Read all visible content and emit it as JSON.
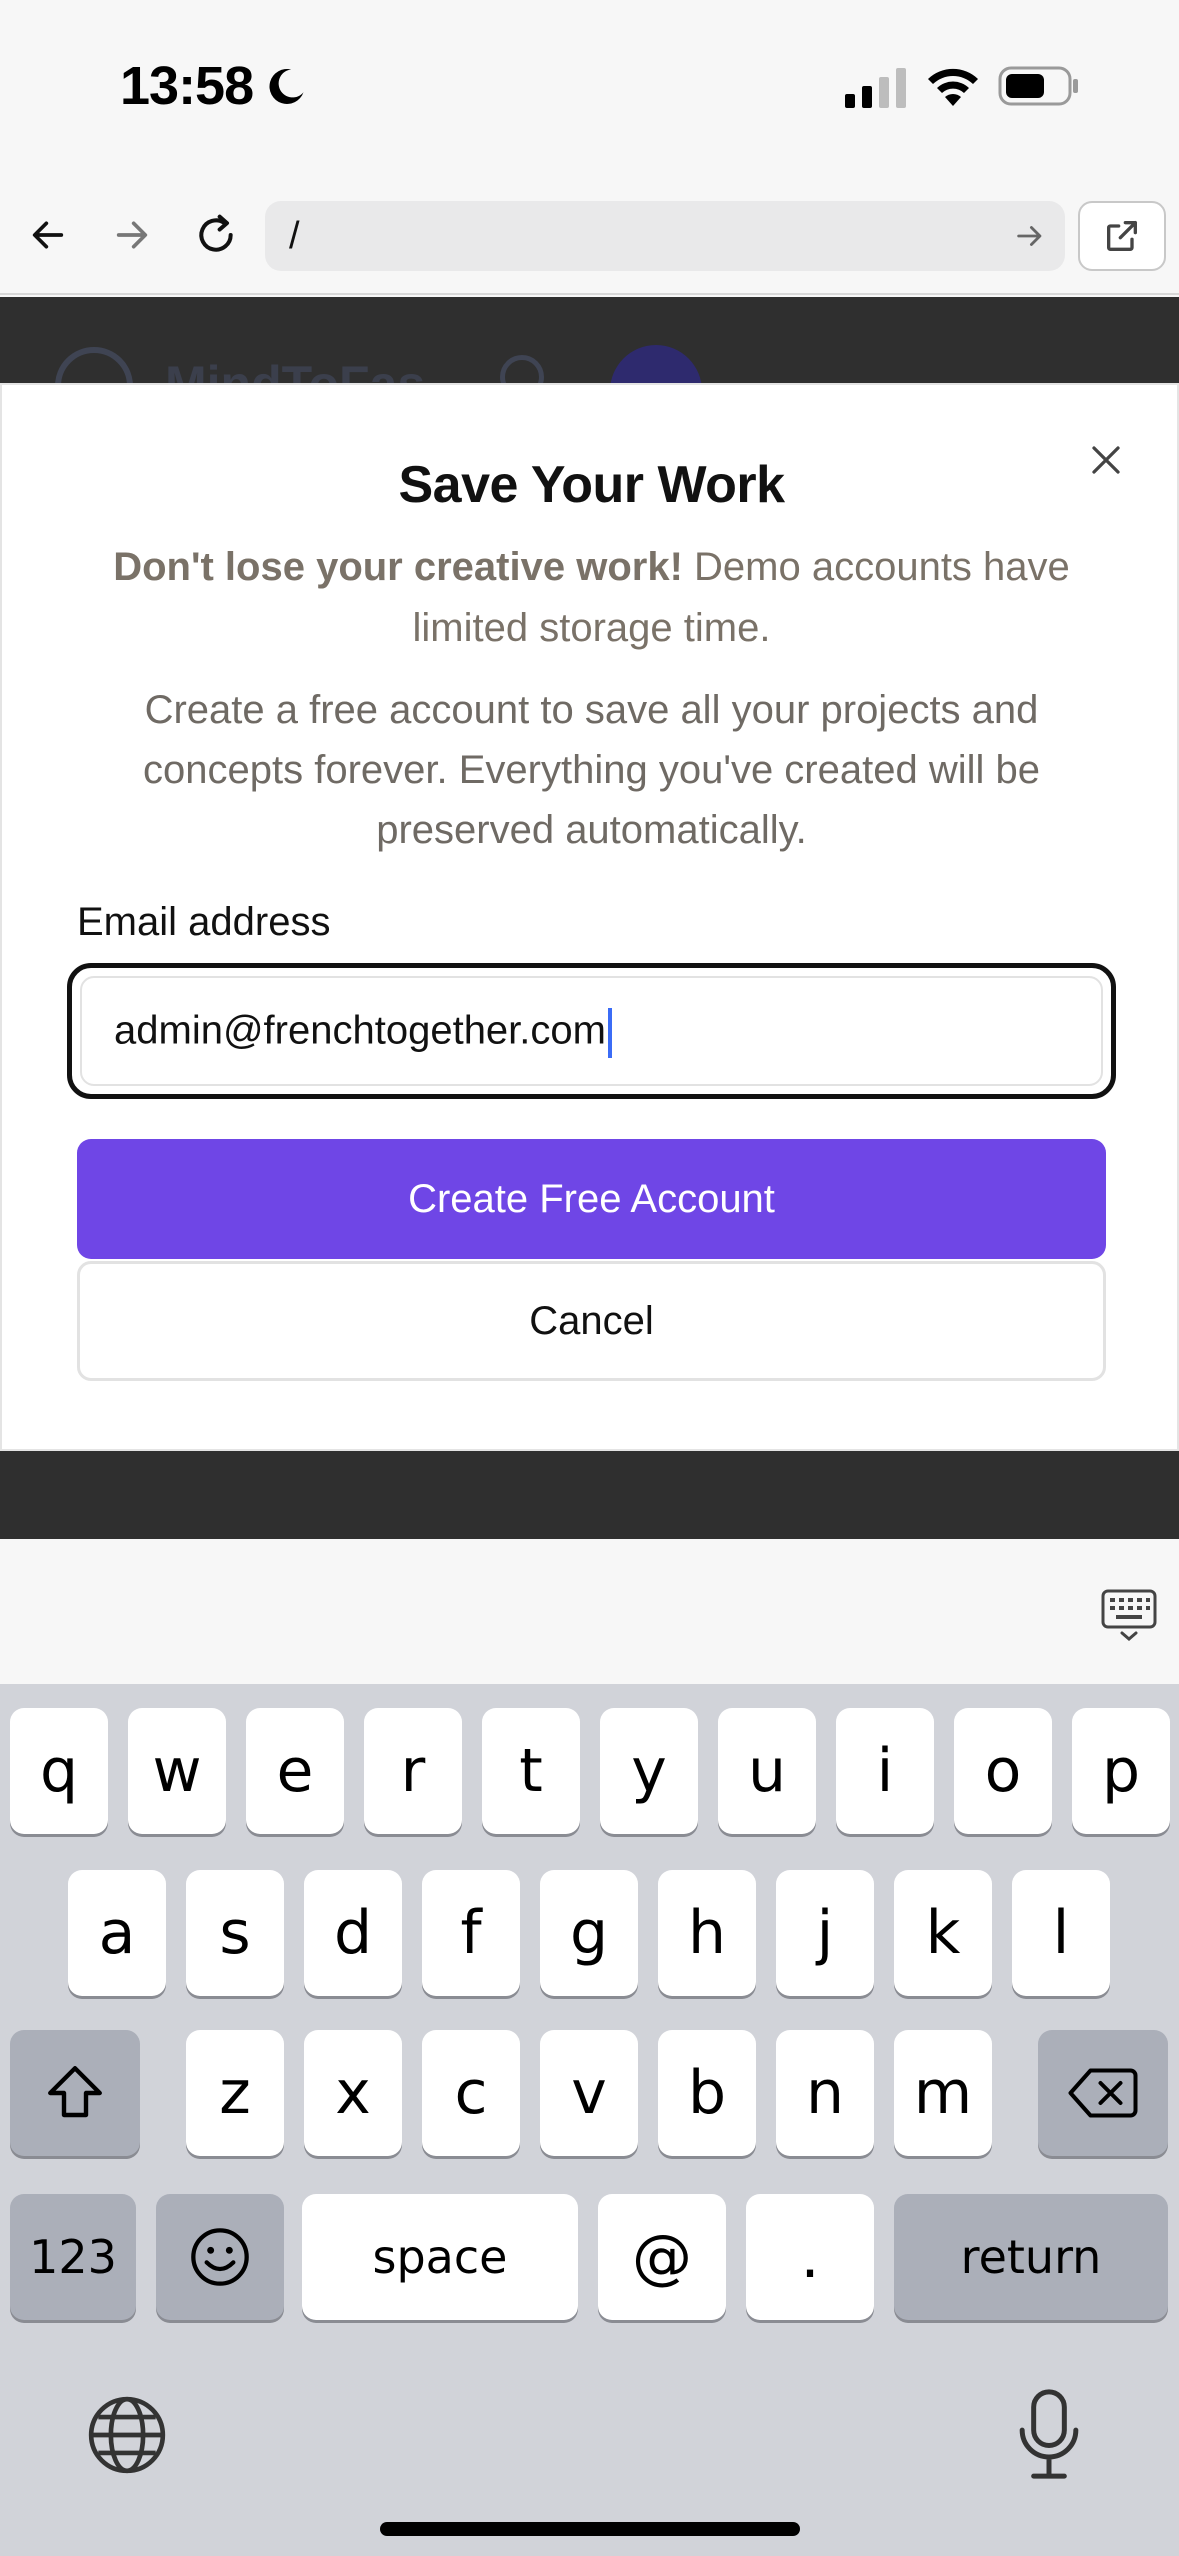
{
  "status_bar": {
    "time": "13:58"
  },
  "browser": {
    "url": "/"
  },
  "background_app": {
    "brand": "MindToFas"
  },
  "modal": {
    "title": "Save Your Work",
    "lead_bold": "Don't lose your creative work!",
    "lead_rest": "Demo accounts have limited storage time.",
    "description": "Create a free account to save all your projects and concepts forever. Everything you've created will be preserved automatically.",
    "email_label": "Email address",
    "email_value": "admin@frenchtogether.com",
    "primary_button": "Create Free Account",
    "cancel_button": "Cancel",
    "accent_color": "#6f46e6"
  },
  "keyboard": {
    "row1": [
      "q",
      "w",
      "e",
      "r",
      "t",
      "y",
      "u",
      "i",
      "o",
      "p"
    ],
    "row2": [
      "a",
      "s",
      "d",
      "f",
      "g",
      "h",
      "j",
      "k",
      "l"
    ],
    "row3": [
      "z",
      "x",
      "c",
      "v",
      "b",
      "n",
      "m"
    ],
    "numbers_key": "123",
    "space_key": "space",
    "at_key": "@",
    "dot_key": ".",
    "return_key": "return"
  }
}
